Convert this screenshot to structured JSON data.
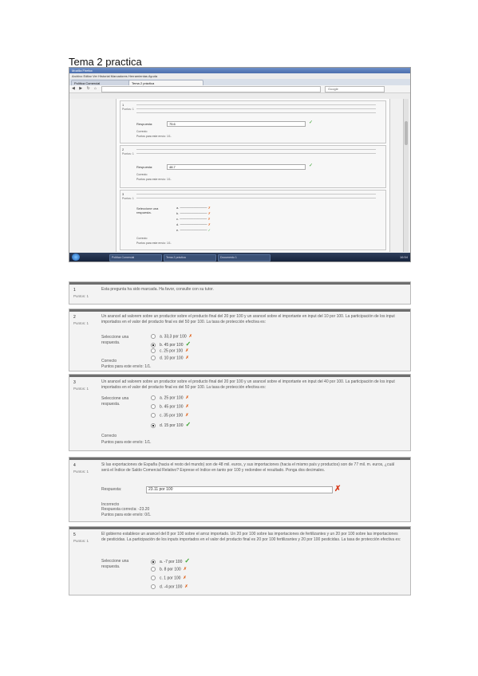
{
  "doc_title": "Tema 2 practica",
  "screenshot": {
    "window_title": "Mozilla Firefox",
    "menu": "Archivo  Editar  Ver  Historial  Marcadores  Herramientas  Ayuda",
    "tabs": [
      "Política Comercial",
      "Tema 2 práctica"
    ],
    "search_placeholder": "Google",
    "questions": [
      {
        "num": "1",
        "pts": "Puntos: 1",
        "label": "Respuesta:",
        "value": "75.6",
        "feedback": "Correcto",
        "score": "Puntos para este envío: 1/1."
      },
      {
        "num": "2",
        "pts": "Puntos: 1",
        "label": "Respuesta:",
        "value": "48.7",
        "feedback": "Correcto",
        "score": "Puntos para este envío: 1/1."
      },
      {
        "num": "3",
        "pts": "Puntos: 1",
        "label": "Seleccione una respuesta.",
        "options": [
          {
            "text": "a.",
            "mark": "x"
          },
          {
            "text": "b.",
            "mark": "x"
          },
          {
            "text": "c.",
            "mark": "x"
          },
          {
            "text": "d.",
            "mark": "x"
          },
          {
            "text": "e.",
            "mark": "ok"
          }
        ],
        "feedback": "Correcto",
        "score": "Puntos para este envío: 1/1."
      }
    ],
    "taskbar": [
      "Política Comercial",
      "Tema 2 práctica",
      "Documento 1"
    ],
    "clock": "16:54"
  },
  "quiz": [
    {
      "num": "1",
      "pts": "Puntos: 1",
      "text": "Esta pregunta ha sido marcada. Ha favor, consulte con su tutor."
    },
    {
      "num": "2",
      "pts": "Puntos: 1",
      "text": "Un arancel ad valorem sobre un productor sobre el producto final del 20 por 100 y un arancel sobre el importante en input del 10 por 100. La participación de los input importados en el valor del producto final es del 50 por 100. La tasa de protección efectiva es:",
      "select_label": "Seleccione una respuesta.",
      "options": [
        {
          "letter": "a.",
          "text": "33,3 por 100",
          "mark": "x",
          "selected": false
        },
        {
          "letter": "b.",
          "text": "45 por 100",
          "mark": "ok",
          "selected": true
        },
        {
          "letter": "c.",
          "text": "25 por 100",
          "mark": "x",
          "selected": false
        },
        {
          "letter": "d.",
          "text": "10 por 100",
          "mark": "x",
          "selected": false
        }
      ],
      "feedback": "Correcto",
      "score": "Puntos para este envío: 1/1."
    },
    {
      "num": "3",
      "pts": "Puntos: 1",
      "text": "Un arancel ad valorem sobre un productor sobre el producto final del 20 por 100 y un arancel sobre el importante en input del 40 por 100. La participación de los input importados en el valor del producto final es del 50 por 100. La tasa de protección efectiva es:",
      "select_label": "Seleccione una respuesta.",
      "options": [
        {
          "letter": "a.",
          "text": "25 por 100",
          "mark": "x",
          "selected": false
        },
        {
          "letter": "b.",
          "text": "45 por 100",
          "mark": "x",
          "selected": false
        },
        {
          "letter": "c.",
          "text": "35 por 100",
          "mark": "x",
          "selected": false
        },
        {
          "letter": "d.",
          "text": "15 por 100",
          "mark": "ok",
          "selected": true
        }
      ],
      "feedback": "Correcto",
      "score": "Puntos para este envío: 1/1."
    },
    {
      "num": "4",
      "pts": "Puntos: 1",
      "text": "Si las exportaciones de España (hacia el resto del mundo) son de 48 mil. euros, y sus importaciones (hacia el mismo país y productos) son de 77 mil. m. euros, ¿cuál será el Índice de Saldo Comercial Relativo? Exprese el índice en tanto por 100 y redondee el resultado. Ponga dos decimales.",
      "resp_label": "Respuesta:",
      "resp_value": "23.11 por 100",
      "feedback": "Incorrecto",
      "correct": "Respuesta correcta: -23.20",
      "score": "Puntos para este envío: 0/1."
    },
    {
      "num": "5",
      "pts": "Puntos: 1",
      "text": "El gobierno establece un arancel del 8 por 100 sobre el arroz importado. Un 20 por 100 sobre las importaciones de fertilizantes y un 20 por 100 sobre las importaciones de pesticidas. La participación de los inputs importados en el valor del producto final es 20 por 100 fertilizantes y 20 por 100 pesticidas. La tasa de protección efectiva es:",
      "select_label": "Seleccione una respuesta.",
      "options": [
        {
          "letter": "a.",
          "text": "-7 por 100",
          "mark": "ok",
          "selected": true
        },
        {
          "letter": "b.",
          "text": "8 por 100",
          "mark": "x",
          "selected": false
        },
        {
          "letter": "c.",
          "text": "1 por 100",
          "mark": "x",
          "selected": false
        },
        {
          "letter": "d.",
          "text": "-4 por 100",
          "mark": "x",
          "selected": false
        }
      ],
      "feedback": "",
      "score": ""
    }
  ]
}
